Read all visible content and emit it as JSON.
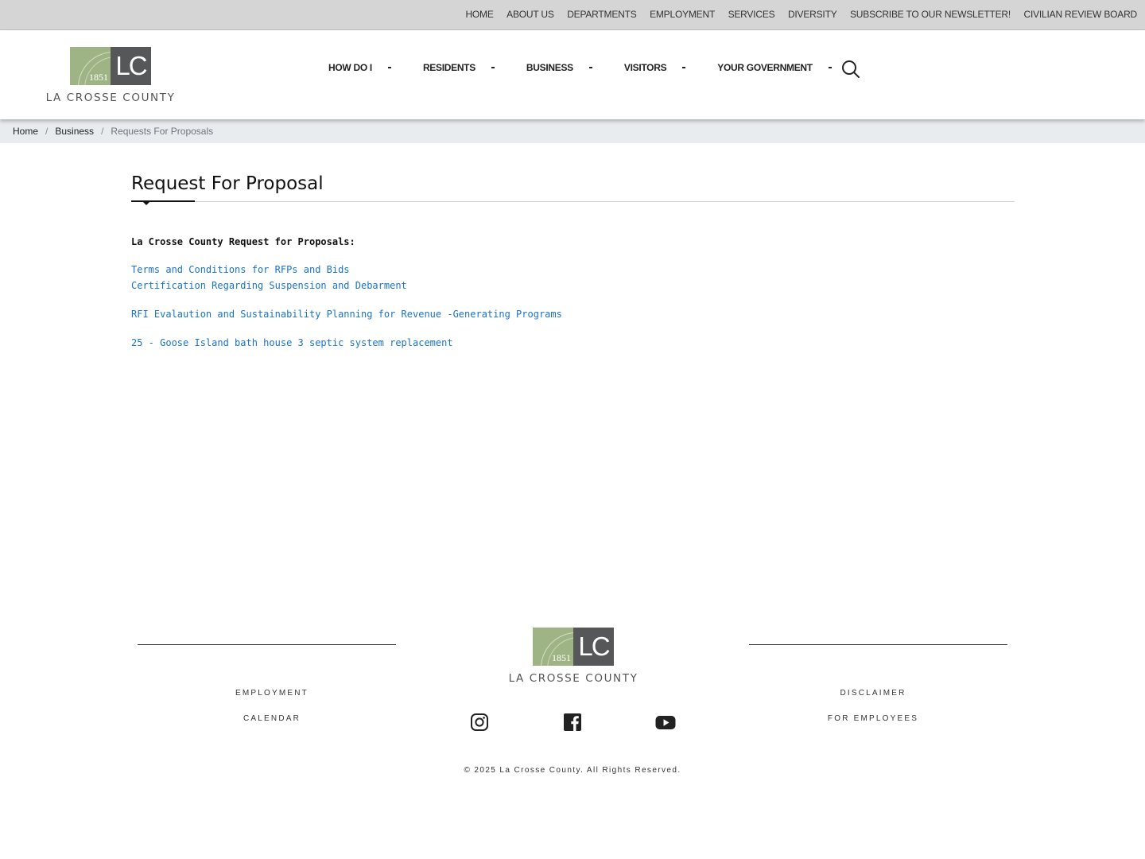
{
  "utility_nav": {
    "items": [
      {
        "label": "HOME"
      },
      {
        "label": "ABOUT US"
      },
      {
        "label": "DEPARTMENTS"
      },
      {
        "label": "EMPLOYMENT"
      },
      {
        "label": "SERVICES"
      },
      {
        "label": "DIVERSITY"
      },
      {
        "label": "SUBSCRIBE TO OUR NEWSLETTER!"
      },
      {
        "label": "CIVILIAN REVIEW BOARD"
      }
    ]
  },
  "logo": {
    "year": "1851",
    "initials": "LC",
    "name": "LA CROSSE COUNTY",
    "colors": {
      "green": "#9fb484",
      "gray": "#555759"
    }
  },
  "main_nav": {
    "items": [
      {
        "label": "HOW DO I"
      },
      {
        "label": "RESIDENTS"
      },
      {
        "label": "BUSINESS"
      },
      {
        "label": "VISITORS"
      },
      {
        "label": "YOUR GOVERNMENT"
      }
    ],
    "search_icon": "search-icon"
  },
  "breadcrumb": {
    "items": [
      "Home",
      "Business"
    ],
    "current": "Requests For Proposals"
  },
  "content": {
    "title": "Request For Proposal",
    "intro": "La Crosse County Request for Proposals:",
    "link_groups": [
      [
        "Terms and Conditions for RFPs and Bids",
        "Certification Regarding Suspension and Debarment"
      ],
      [
        "RFI Evalaution and Sustainability Planning for Revenue -Generating Programs"
      ],
      [
        "25 - Goose Island bath house 3 septic system replacement"
      ]
    ],
    "link_color": "#1a73c7"
  },
  "footer": {
    "left_links": [
      "EMPLOYMENT",
      "CALENDAR"
    ],
    "right_links": [
      "DISCLAIMER",
      "FOR EMPLOYEES"
    ],
    "social": [
      "instagram-icon",
      "facebook-icon",
      "youtube-icon"
    ],
    "copyright": "© 2025 La Crosse County. All Rights Reserved."
  }
}
